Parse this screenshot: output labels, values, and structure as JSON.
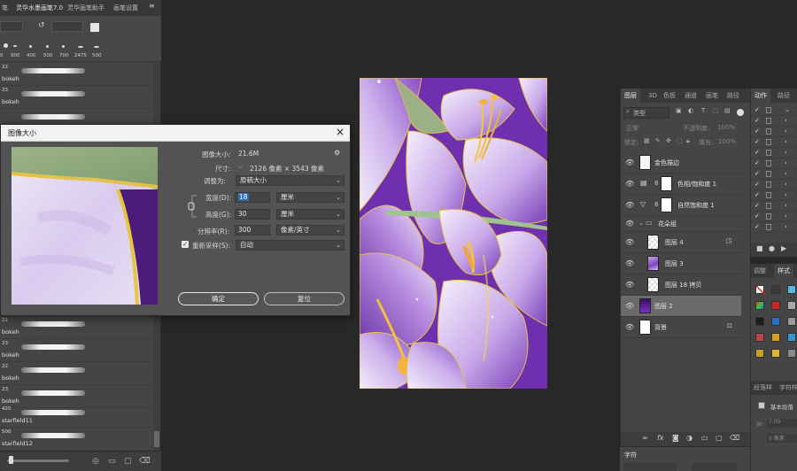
{
  "brushes_panel": {
    "tabs": [
      "笔",
      "灵华水墨画笔7.0",
      "灵华画笔助手",
      "画笔设置"
    ],
    "size_presets": [
      "0",
      "900",
      "400",
      "500",
      "700",
      "2475",
      "500"
    ],
    "brushes": [
      {
        "num": "22",
        "name": "bokeh"
      },
      {
        "num": "23",
        "name": "bokeh"
      },
      {
        "num": "",
        "name": ""
      },
      {
        "num": "",
        "name": ""
      },
      {
        "num": "",
        "name": ""
      },
      {
        "num": "",
        "name": ""
      },
      {
        "num": "",
        "name": ""
      },
      {
        "num": "",
        "name": ""
      },
      {
        "num": "",
        "name": ""
      },
      {
        "num": "",
        "name": ""
      },
      {
        "num": "",
        "name": ""
      },
      {
        "num": "22",
        "name": "bokeh"
      },
      {
        "num": "23",
        "name": "bokeh"
      },
      {
        "num": "22",
        "name": "bokeh"
      },
      {
        "num": "23",
        "name": "bokeh"
      },
      {
        "num": "420",
        "name": "starfield11"
      },
      {
        "num": "500",
        "name": "starfield12"
      }
    ]
  },
  "dialog": {
    "title": "图像大小",
    "image_size_label": "图像大小:",
    "image_size_value": "21.6M",
    "dimensions_label": "尺寸:",
    "dimensions_value": "2126 像素 × 3543 像素",
    "fit_to_label": "调整为:",
    "fit_to_value": "原稿大小",
    "width_label": "宽度(D):",
    "width_value": "18",
    "width_unit": "厘米",
    "height_label": "高度(G):",
    "height_value": "30",
    "height_unit": "厘米",
    "resolution_label": "分辨率(R):",
    "resolution_value": "300",
    "resolution_unit": "像素/英寸",
    "resample_label": "重新采样(S):",
    "resample_value": "自动",
    "resample_checked": true,
    "ok_label": "确定",
    "reset_label": "复位"
  },
  "layers_panel": {
    "tabs": [
      "图层",
      "3D",
      "色板",
      "通道",
      "画笔",
      "路径"
    ],
    "filter_label": "类型",
    "blend_mode": "正常",
    "opacity_label": "不透明度:",
    "opacity_value": "100%",
    "lock_label": "锁定:",
    "fill_label": "填充:",
    "fill_value": "100%",
    "layers": [
      {
        "name": "金色描边",
        "kind": "layer",
        "selected": false,
        "visible": true
      },
      {
        "name": "色相/饱和度 1",
        "kind": "adjustment",
        "selected": false,
        "visible": true
      },
      {
        "name": "自然饱和度 1",
        "kind": "adjustment",
        "selected": false,
        "visible": true
      },
      {
        "name": "花朵组",
        "kind": "group",
        "selected": false,
        "visible": true
      },
      {
        "name": "图层 4",
        "kind": "layer",
        "selected": false,
        "visible": true
      },
      {
        "name": "图层 3",
        "kind": "layer",
        "selected": false,
        "visible": true
      },
      {
        "name": "图层 18 拷贝",
        "kind": "layer",
        "selected": false,
        "visible": true
      },
      {
        "name": "图层 2",
        "kind": "layer",
        "selected": true,
        "visible": true
      },
      {
        "name": "背景",
        "kind": "background",
        "selected": false,
        "visible": true
      }
    ]
  },
  "character_panel": {
    "title": "字符"
  },
  "actions_panel": {
    "tabs": [
      "动作",
      "路径"
    ],
    "row_count": 12
  },
  "styles_panel": {
    "tabs": [
      "调整",
      "样式"
    ]
  },
  "paragraph_panel": {
    "tabs": [
      "段落样",
      "字符样"
    ],
    "item_label": "基本段落",
    "w_label": "W:",
    "w_value": "7.09",
    "field2_value": "0 像素"
  },
  "colors": {
    "accent_selection": "#6a6a6a",
    "canvas_purple": "#7a35b8",
    "gold": "#e8c042"
  }
}
